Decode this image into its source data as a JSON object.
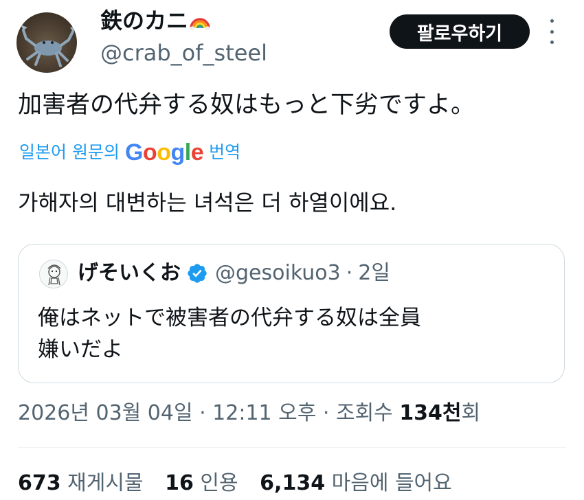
{
  "author": {
    "display_name": "鉄のカニ",
    "handle": "@crab_of_steel"
  },
  "follow_label": "팔로우하기",
  "tweet": {
    "text": "加害者の代弁する奴はもっと下劣ですよ。",
    "translate_prefix": "일본어 원문의",
    "translate_brand": "Google",
    "translate_suffix": "번역",
    "translated_text": "가해자의 대변하는 녀석은 더 하열이에요."
  },
  "quote": {
    "name": "げそいくお",
    "handle": "@gesoikuo3",
    "separator": "·",
    "date": "2일",
    "text_line1": "俺はネットで被害者の代弁する奴は全員",
    "text_line2": "嫌いだよ"
  },
  "meta": {
    "datetime": "2026년 03월 04일 · 12:11 오후 · 조회수 ",
    "views_number": "134천",
    "views_suffix": "회"
  },
  "stats": {
    "reposts_count": "673",
    "reposts_label": "재게시물",
    "quotes_count": "16",
    "quotes_label": "인용",
    "likes_count": "6,134",
    "likes_label": "마음에 들어요"
  },
  "colors": {
    "link": "#1d9bf0",
    "verified": "#1d9bf0",
    "muted": "#536471",
    "follow_bg": "#0f1419"
  },
  "icons": [
    "rainbow-icon",
    "more-icon",
    "verified-badge-icon"
  ]
}
